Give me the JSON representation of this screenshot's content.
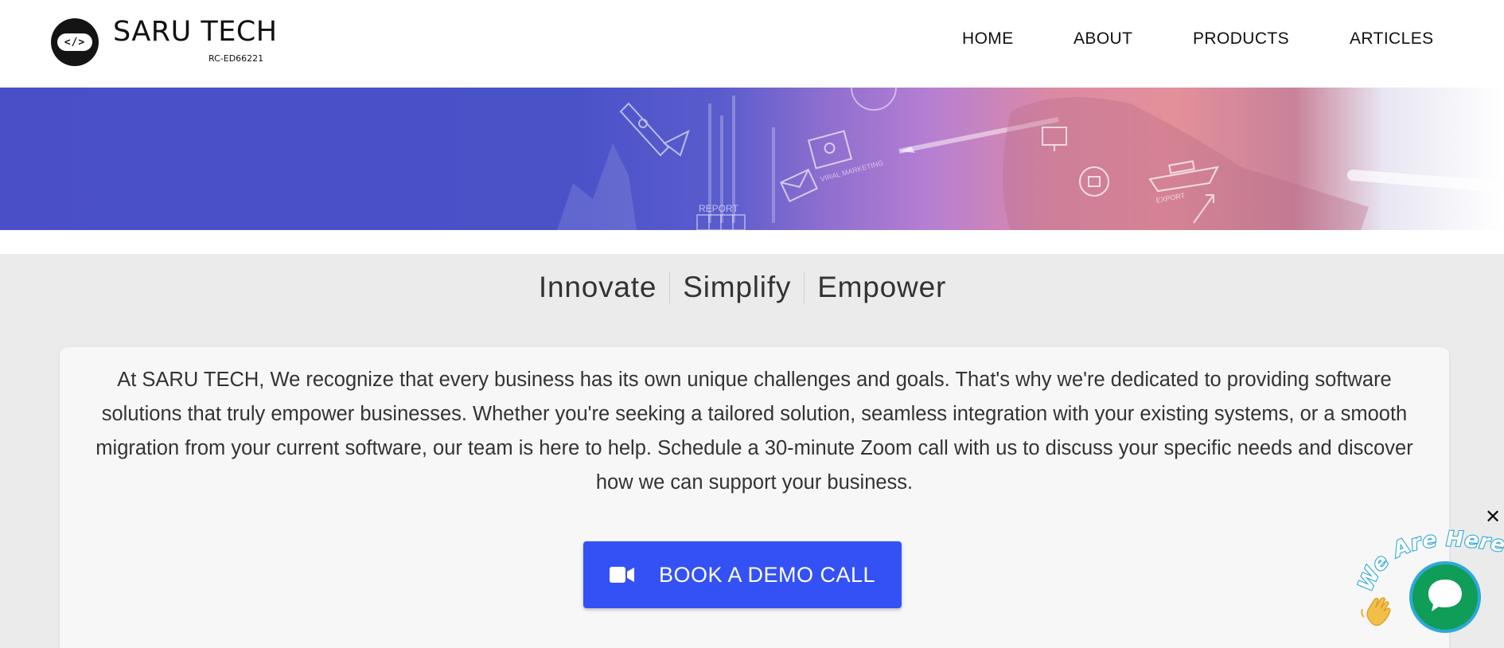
{
  "header": {
    "logo_glyph": "</>",
    "brand_name": "SARU TECH",
    "brand_sub": "RC-ED66221",
    "nav": [
      "HOME",
      "ABOUT",
      "PRODUCTS",
      "ARTICLES"
    ]
  },
  "hero": {
    "icons": [
      "rocket-icon",
      "chart-icon",
      "envelope-icon",
      "monitor-icon",
      "ship-icon",
      "pen-icon"
    ],
    "labels": [
      "REPORT",
      "VIRAL MARKETING",
      "EXPORT"
    ]
  },
  "tagline": [
    "Innovate",
    "Simplify",
    "Empower"
  ],
  "intro": {
    "text": "At SARU TECH, We recognize that every business has its own unique challenges and goals. That's why we're dedicated to providing software solutions that truly empower businesses. Whether you're seeking a tailored solution, seamless integration with your existing systems, or a smooth migration from your current software, our team is here to help. Schedule a 30-minute Zoom call with us to discuss your specific needs and discover how we can support your business."
  },
  "cta": {
    "label": "BOOK A DEMO CALL",
    "icon": "video-camera-icon",
    "color": "#3451f5"
  },
  "chat_widget": {
    "banner": "We Are Here!",
    "close_glyph": "✕",
    "icons": [
      "waving-hand-icon",
      "chat-bubble-icon"
    ],
    "color": "#0f9d58"
  }
}
